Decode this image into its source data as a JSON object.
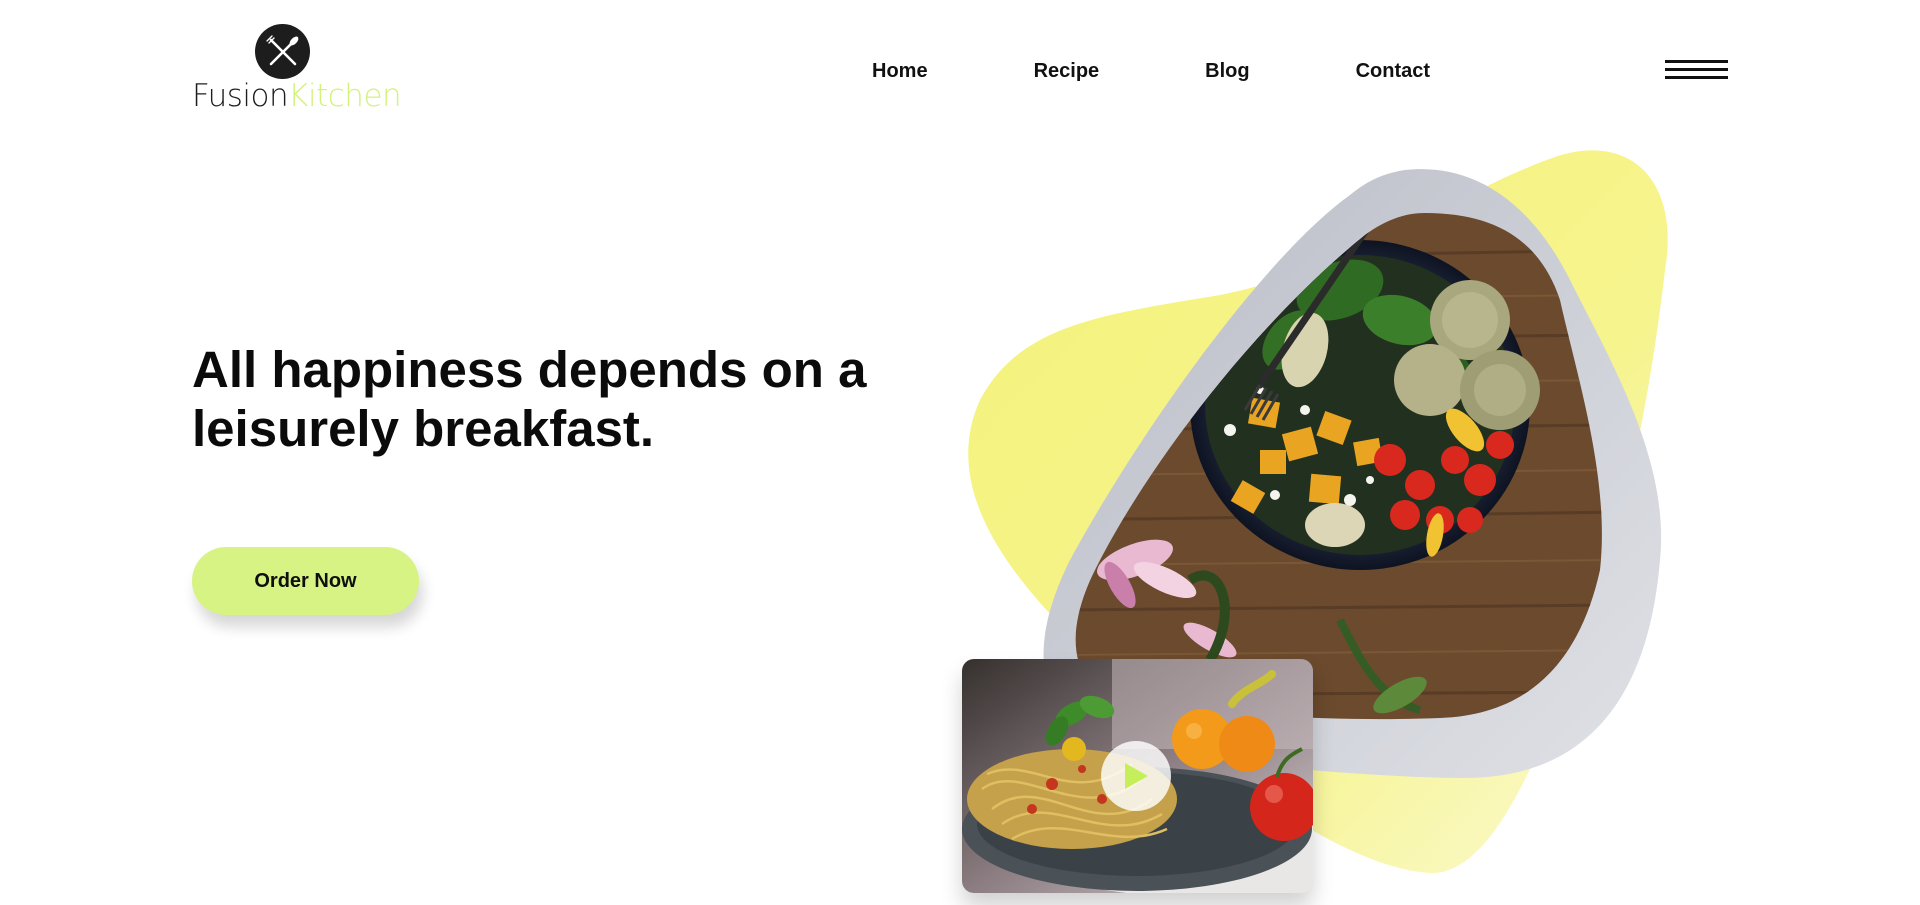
{
  "brand": {
    "name_part1": "Fusion",
    "name_part2": "Kitchen",
    "logo_icon": "fork-knife-icon",
    "accent_color": "#d3f27c"
  },
  "nav": {
    "items": [
      {
        "label": "Home"
      },
      {
        "label": "Recipe"
      },
      {
        "label": "Blog"
      },
      {
        "label": "Contact"
      }
    ],
    "menu_icon": "hamburger-menu-icon"
  },
  "hero": {
    "headline": "All happiness depends on a leisurely breakfast.",
    "cta_label": "Order Now",
    "cta_color": "#d7f383"
  },
  "media": {
    "main_image": "salad-bowl-image",
    "video_thumbnail": "pasta-plate-image",
    "play_icon": "play-icon",
    "blob_color": "#f5f37a",
    "frame_color": "#c3c6ce"
  }
}
